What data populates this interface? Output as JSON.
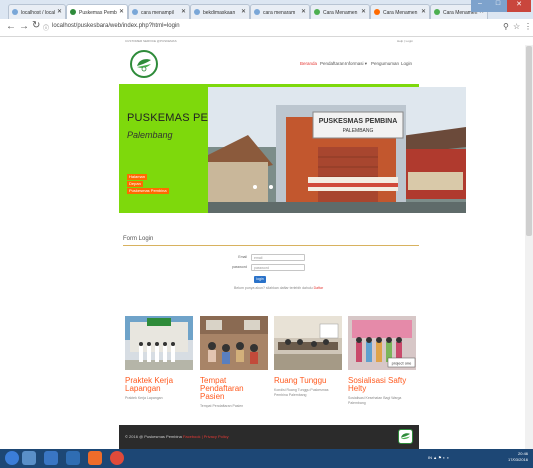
{
  "browser": {
    "tabs": [
      {
        "label": "localhost / local"
      },
      {
        "label": "Puskemas Pemb"
      },
      {
        "label": "cara menampil"
      },
      {
        "label": "bekdimaskaan"
      },
      {
        "label": "cara menaram"
      },
      {
        "label": "Cara Menamen"
      },
      {
        "label": "Cara Menamen"
      },
      {
        "label": "Cara Menamen"
      }
    ],
    "url": "localhost/puskesbara/web/index.php?html=login"
  },
  "site": {
    "top_left": "CUSTOMER SERVICE @PUSKEMAS",
    "top_right": "Help  |  Login",
    "menu": [
      {
        "label": "Beranda"
      },
      {
        "label": "Pendaftaran"
      },
      {
        "label": "Informasi ▾"
      },
      {
        "label": "Pengumuman"
      },
      {
        "label": "Login"
      }
    ],
    "hero": {
      "title": "PUSKEMAS PEMBINA",
      "subtitle": "Palembang",
      "links": [
        {
          "label": "Halaman"
        },
        {
          "label": "Depan"
        },
        {
          "label": "Puskesmas Pembina"
        }
      ],
      "sign_line1": "PUSKESMAS PEMBINA",
      "sign_line2": "PALEMBANG"
    },
    "login": {
      "title": "Form Login",
      "email_label": "Email",
      "email_placeholder": "email",
      "password_label": "password",
      "password_placeholder": "password",
      "button": "login",
      "register_text": "Belum punya akun? silahkan daftar terlebih dahulu",
      "register_link": "Daftar"
    },
    "cards": [
      {
        "title": "Praktek Kerja Lapangan",
        "desc": "Praktek Kerja Lapangan"
      },
      {
        "title": "Tempat Pendaftaran Pasien",
        "desc": "Tempat Pendaftaran Pasien"
      },
      {
        "title": "Ruang Tunggu",
        "desc": "Kondisi Ruang Tunggu Puskesmas Pembina Palembang"
      },
      {
        "title": "Sosialisasi Safty Helty",
        "desc": "Sosialisasi Kesehatan Bagi Warga Palembang"
      }
    ],
    "card_badge": "project one",
    "footer": {
      "copyright": "© 2016 @ Puskesmas Pembina",
      "links": "Facebook | Privacy Policy"
    }
  },
  "taskbar": {
    "tray": "IN ▲ ⚑ ◐ ◑",
    "time": "20:46",
    "date": "17/03/2016"
  },
  "colors": {
    "hero_bg": "#7ed90c",
    "accent": "#ff6a00",
    "active_menu": "#e53935",
    "footer_bg": "#2b2b2b",
    "taskbar_bg": "#1d4775"
  }
}
